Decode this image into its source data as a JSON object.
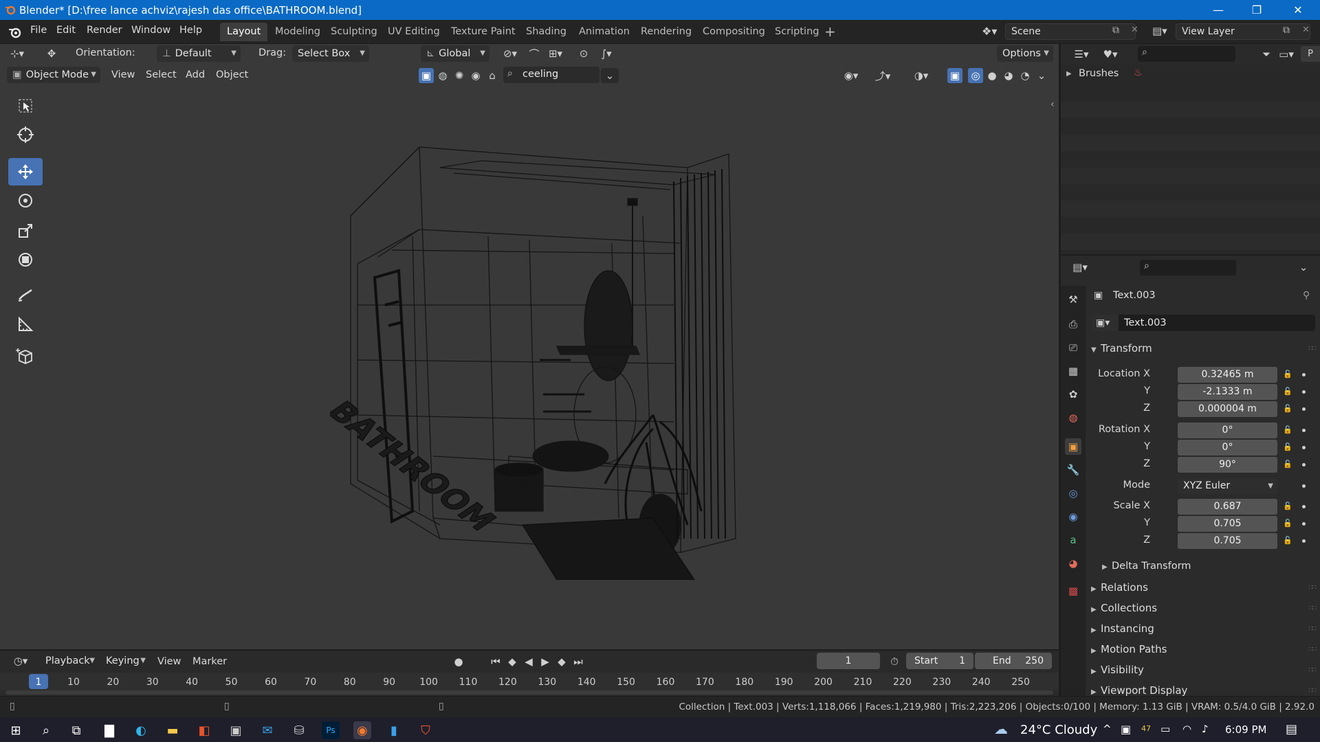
{
  "window": {
    "title": "Blender* [D:\\free lance achviz\\rajesh das office\\BATHROOM.blend]",
    "minimize": "—",
    "maximize": "❐",
    "close": "✕"
  },
  "menu": [
    "File",
    "Edit",
    "Render",
    "Window",
    "Help"
  ],
  "workspaces": [
    "Layout",
    "Modeling",
    "Sculpting",
    "UV Editing",
    "Texture Paint",
    "Shading",
    "Animation",
    "Rendering",
    "Compositing",
    "Scripting"
  ],
  "active_workspace": "Layout",
  "scene": {
    "label": "Scene",
    "view_layer": "View Layer"
  },
  "tool_header": {
    "orientation_label": "Orientation:",
    "orientation_value": "Default",
    "drag_label": "Drag:",
    "drag_value": "Select Box",
    "transform_orientation": "Global",
    "options": "Options"
  },
  "viewport_header": {
    "mode": "Object Mode",
    "menus": [
      "View",
      "Select",
      "Add",
      "Object"
    ],
    "filter_text": "ceeling"
  },
  "viewport_scene": {
    "floor_text": "BATHROOM"
  },
  "outliner": {
    "brushes_label": "Brushes"
  },
  "properties": {
    "object_name": "Text.003",
    "object_field": "Text.003",
    "transform_header": "Transform",
    "location": {
      "label": "Location X",
      "x": "0.32465 m",
      "y": "-2.1333 m",
      "z": "0.000004 m"
    },
    "rotation": {
      "label": "Rotation X",
      "x": "0°",
      "y": "0°",
      "z": "90°"
    },
    "mode_label": "Mode",
    "mode_value": "XYZ Euler",
    "scale": {
      "label": "Scale X",
      "x": "0.687",
      "y": "0.705",
      "z": "0.705"
    },
    "axis_y": "Y",
    "axis_z": "Z",
    "collapsed_panels": [
      "Delta Transform",
      "Relations",
      "Collections",
      "Instancing",
      "Motion Paths",
      "Visibility",
      "Viewport Display"
    ]
  },
  "timeline": {
    "menus": [
      "Playback",
      "Keying",
      "View",
      "Marker"
    ],
    "current_frame": "1",
    "start_label": "Start",
    "start_value": "1",
    "end_label": "End",
    "end_value": "250",
    "ruler": [
      "1",
      "10",
      "20",
      "30",
      "40",
      "50",
      "60",
      "70",
      "80",
      "90",
      "100",
      "110",
      "120",
      "130",
      "140",
      "150",
      "160",
      "170",
      "180",
      "190",
      "200",
      "210",
      "220",
      "230",
      "240",
      "250"
    ]
  },
  "statusbar": {
    "text": "Collection | Text.003 | Verts:1,118,066 | Faces:1,219,980 | Tris:2,223,206 | Objects:0/100 | Memory: 1.13 GiB | VRAM: 0.5/4.0 GiB | 2.92.0"
  },
  "taskbar": {
    "weather": "24°C  Cloudy",
    "time": "6:09 PM",
    "badge": "47"
  },
  "colors": {
    "accent": "#4772b3",
    "titlebar": "#0a6ac5",
    "viewport_bg": "#393939",
    "panel_bg": "#2b2b2b",
    "frame_marker": "#4772b3"
  }
}
